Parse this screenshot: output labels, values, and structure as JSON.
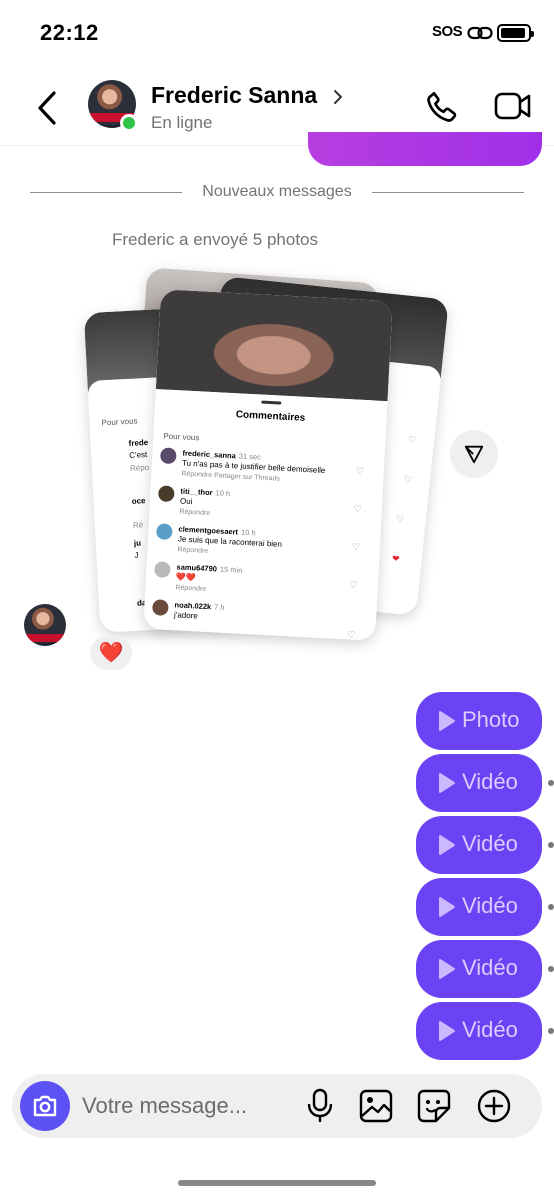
{
  "status_bar": {
    "time": "22:12",
    "sos": "SOS",
    "battery_level": 0.85
  },
  "header": {
    "contact_name": "Frederic Sanna",
    "contact_status": "En ligne",
    "back_icon": "chevron-left-icon",
    "call_icon": "phone-icon",
    "video_icon": "video-camera-icon"
  },
  "divider": {
    "label": "Nouveaux messages"
  },
  "photo_message": {
    "caption": "Frederic a envoyé 5 photos",
    "comments_sheet": {
      "title": "Commentaires",
      "filter": "Pour vous",
      "comments": [
        {
          "user": "frederic_sanna",
          "time": "31 sec",
          "text": "Tu n'as pas à te justifier belle demoiselle",
          "actions": "Répondre     Partager sur Threads"
        },
        {
          "user": "titi__thor",
          "time": "10 h",
          "text": "Oui",
          "actions": "Répondre"
        },
        {
          "user": "clementgoesaert",
          "time": "10 h",
          "text": "Je suis que la raconterai bien",
          "actions": "Répondre"
        },
        {
          "user": "samu64790",
          "time": "15 min",
          "text": "❤️❤️",
          "actions": "Répondre"
        },
        {
          "user": "noah.022k",
          "time": "7 h",
          "text": "j'adore",
          "actions": ""
        }
      ]
    },
    "back_card": {
      "filter": "Pour vous",
      "snippets": [
        "frede",
        "C'est",
        "Répo",
        "oce",
        "Ré",
        "ju",
        "J",
        "da"
      ]
    },
    "reaction": "❤️"
  },
  "media_messages": [
    {
      "label": "Photo"
    },
    {
      "label": "Vidéo"
    },
    {
      "label": "Vidéo"
    },
    {
      "label": "Vidéo"
    },
    {
      "label": "Vidéo"
    },
    {
      "label": "Vidéo"
    }
  ],
  "composer": {
    "placeholder": "Votre message...",
    "icons": [
      "camera-icon",
      "microphone-icon",
      "image-icon",
      "sticker-icon",
      "plus-icon"
    ]
  },
  "colors": {
    "accent": "#6c42f5",
    "bubble_gradient": "#b73ee0",
    "online": "#2ec44a",
    "camera_button": "#5b51f5"
  }
}
